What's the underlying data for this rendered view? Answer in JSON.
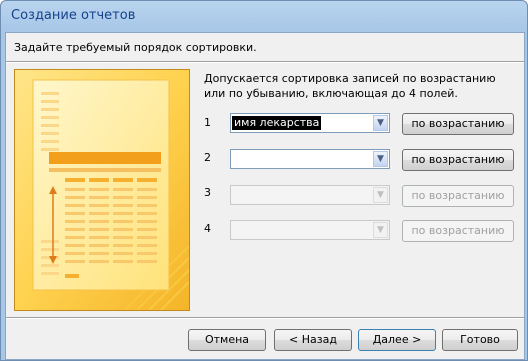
{
  "window": {
    "title": "Создание отчетов"
  },
  "wizard": {
    "prompt": "Задайте требуемый порядок сортировки.",
    "description": "Допускается сортировка записей по возрастанию или по убыванию, включающая до 4 полей.",
    "sort_rows": [
      {
        "number": "1",
        "field_value": "имя лекарства",
        "order_label": "по возрастанию",
        "enabled": true
      },
      {
        "number": "2",
        "field_value": "",
        "order_label": "по возрастанию",
        "enabled": true
      },
      {
        "number": "3",
        "field_value": "",
        "order_label": "по возрастанию",
        "enabled": false
      },
      {
        "number": "4",
        "field_value": "",
        "order_label": "по возрастанию",
        "enabled": false
      }
    ]
  },
  "buttons": {
    "cancel": "Отмена",
    "back": "< Назад",
    "next": "Далее >",
    "finish": "Готово"
  },
  "icons": {
    "dropdown": "chevron-down-icon",
    "illustration": "report-sort-illustration"
  },
  "colors": {
    "title_text": "#15428b",
    "illustration_bg": "#ffd75e",
    "illustration_accent": "#f0a020",
    "window_frame": "#a7c7e8"
  }
}
